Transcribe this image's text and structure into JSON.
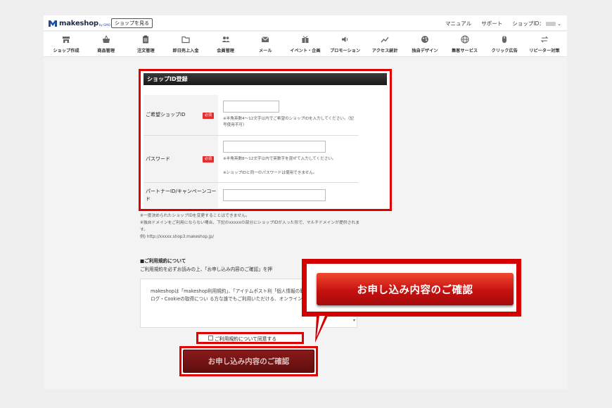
{
  "header": {
    "logo_text": "makeshop",
    "logo_sub": "by GMO",
    "view_shop": "ショップを見る",
    "links": [
      "マニュアル",
      "サポート"
    ],
    "shop_id_label": "ショップID："
  },
  "nav": {
    "items": [
      {
        "label": "ショップ作成",
        "icon": "shop-icon"
      },
      {
        "label": "商品管理",
        "icon": "basket-icon"
      },
      {
        "label": "注文管理",
        "icon": "clipboard-icon"
      },
      {
        "label": "即日売上入金",
        "icon": "folder-icon"
      },
      {
        "label": "会員管理",
        "icon": "users-icon"
      },
      {
        "label": "メール",
        "icon": "mail-icon"
      },
      {
        "label": "イベント・企画",
        "icon": "gift-icon"
      },
      {
        "label": "プロモーション",
        "icon": "speaker-icon"
      },
      {
        "label": "アクセス統計",
        "icon": "chart-icon"
      },
      {
        "label": "独自デザイン",
        "icon": "palette-icon"
      },
      {
        "label": "集客サービス",
        "icon": "globe-icon"
      },
      {
        "label": "クリック広告",
        "icon": "mouse-icon"
      },
      {
        "label": "リピーター対策",
        "icon": "repeat-icon"
      }
    ]
  },
  "form": {
    "title": "ショップID登録",
    "shop_id": {
      "label": "ご希望ショップID",
      "required": "必須",
      "value": "",
      "note": "※半角英数4～12文字以内でご希望のショップIDを入力してください。（記号使用不可）"
    },
    "password": {
      "label": "パスワード",
      "required": "必須",
      "value": "",
      "note1": "※半角英数8～12文字以内で英数字を混ぜて入力してください。",
      "note2": "※ショップIDと同一のパスワードは使用できません。"
    },
    "partner": {
      "label": "パートナーID/キャンペーンコード",
      "value": ""
    }
  },
  "notes": {
    "line1": "※一度決められたショップIDを変更することはできません。",
    "line2": "※独自ドメインをご利用にならない場合、下記のxxxxxの部分にショップIDが入った形で、マルチドメインが提供されます。",
    "line3": "例) http://xxxxx.shop3.makeshop.jp/"
  },
  "terms": {
    "title": "■ご利用規約について",
    "desc": "ご利用規約を必ずお読みの上、「お申し込み内容のご確認」を押",
    "body": "makeshopは「makeshop利用規約」、「アイテムポスト利「個人情報の取り扱い」、「アクセスログ・Cookieの取得につい る方な誰でもご利用いただける、オンラインショップ構築 です。",
    "agree_label": "ご利用規約について同意する"
  },
  "submit_label": "お申し込み内容のご確認",
  "callout_label": "お申し込み内容のご確認",
  "colors": {
    "highlight": "#e00000",
    "button_dark": "#7a1515",
    "button_bright": "#d11a1a"
  }
}
